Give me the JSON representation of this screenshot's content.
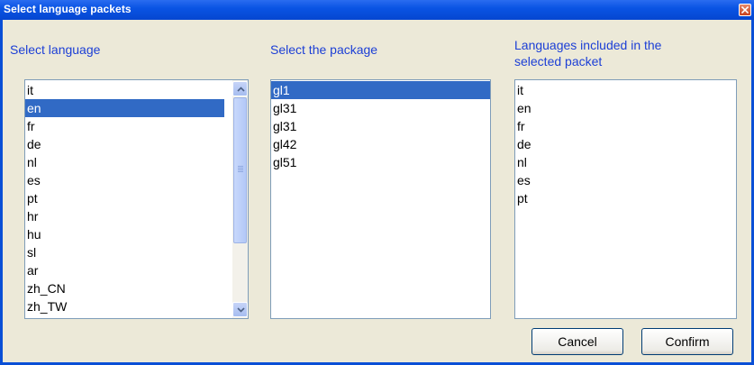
{
  "window": {
    "title": "Select language packets"
  },
  "labels": {
    "select_language": "Select language",
    "select_package": "Select the package",
    "languages_included_line1": "Languages included in the",
    "languages_included_line2": "selected packet"
  },
  "languages": [
    "it",
    "en",
    "fr",
    "de",
    "nl",
    "es",
    "pt",
    "hr",
    "hu",
    "sl",
    "ar",
    "zh_CN",
    "zh_TW"
  ],
  "selected_language": "en",
  "packages": [
    "gl1",
    "gl31",
    "gl31",
    "gl42",
    "gl51"
  ],
  "selected_package": "gl1",
  "included_languages": [
    "it",
    "en",
    "fr",
    "de",
    "nl",
    "es",
    "pt"
  ],
  "buttons": {
    "cancel": "Cancel",
    "confirm": "Confirm"
  },
  "colors": {
    "title_bar": "#0a54e4",
    "label_text": "#1c3fd6",
    "selection": "#316ac5",
    "dialog_bg": "#ece9d8"
  }
}
